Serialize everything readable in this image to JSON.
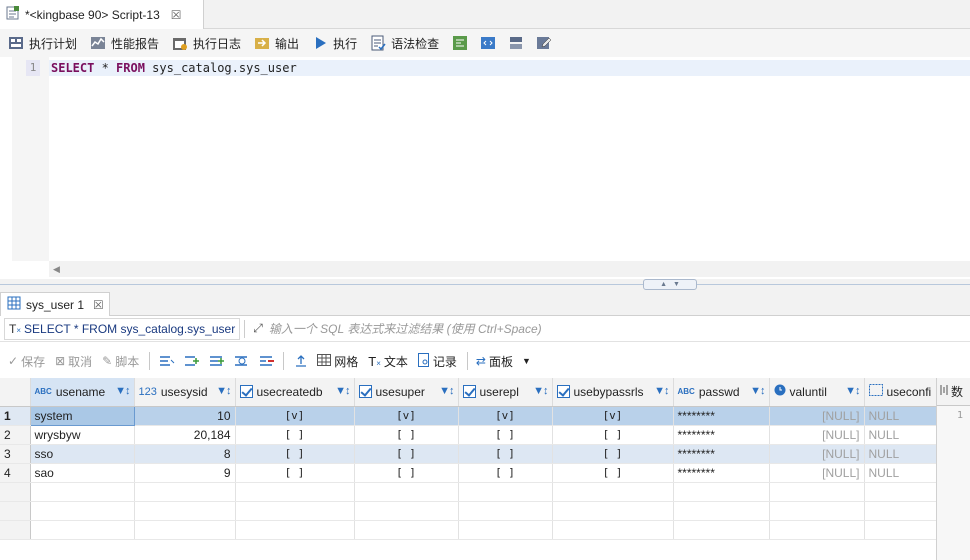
{
  "editor_tab": {
    "title": "*<kingbase 90> Script-13",
    "close": "☒"
  },
  "toolbar": {
    "items": [
      {
        "label": "执行计划"
      },
      {
        "label": "性能报告"
      },
      {
        "label": "执行日志"
      },
      {
        "label": "输出"
      },
      {
        "label": "执行"
      },
      {
        "label": "语法检查"
      }
    ]
  },
  "editor": {
    "line_number": "1",
    "code": {
      "kw1": "SELECT",
      "star": " * ",
      "kw2": "FROM",
      "rest": " sys_catalog.sys_user"
    }
  },
  "results_tab": {
    "title": "sys_user 1",
    "close": "☒"
  },
  "filter": {
    "query": "SELECT * FROM sys_catalog.sys_user",
    "placeholder": "输入一个 SQL 表达式来过滤结果 (使用 Ctrl+Space)"
  },
  "results_toolbar": {
    "save": "保存",
    "cancel": "取消",
    "script": "脚本",
    "grid": "网格",
    "text": "文本",
    "record": "记录",
    "panel": "面板"
  },
  "grid": {
    "columns": [
      {
        "name": "usename",
        "type": "ABC"
      },
      {
        "name": "usesysid",
        "type": "123"
      },
      {
        "name": "usecreatedb",
        "type": "bool"
      },
      {
        "name": "usesuper",
        "type": "bool"
      },
      {
        "name": "userepl",
        "type": "bool"
      },
      {
        "name": "usebypassrls",
        "type": "bool"
      },
      {
        "name": "passwd",
        "type": "ABC"
      },
      {
        "name": "valuntil",
        "type": "time"
      },
      {
        "name": "useconfi",
        "type": "array"
      }
    ],
    "rows": [
      {
        "num": "1",
        "cells": [
          "system",
          "10",
          "[v]",
          "[v]",
          "[v]",
          "[v]",
          "********",
          "[NULL]",
          "NULL"
        ]
      },
      {
        "num": "2",
        "cells": [
          "wrysbyw",
          "20,184",
          "[ ]",
          "[ ]",
          "[ ]",
          "[ ]",
          "********",
          "[NULL]",
          "NULL"
        ]
      },
      {
        "num": "3",
        "cells": [
          "sso",
          "8",
          "[ ]",
          "[ ]",
          "[ ]",
          "[ ]",
          "********",
          "[NULL]",
          "NULL"
        ]
      },
      {
        "num": "4",
        "cells": [
          "sao",
          "9",
          "[ ]",
          "[ ]",
          "[ ]",
          "[ ]",
          "********",
          "[NULL]",
          "NULL"
        ]
      }
    ]
  },
  "side_panel": {
    "title": "数",
    "line": "1"
  },
  "colors": {
    "accent": "#2a6fbf",
    "selection": "#b9d1ea",
    "alt_row": "#dde7f3"
  }
}
